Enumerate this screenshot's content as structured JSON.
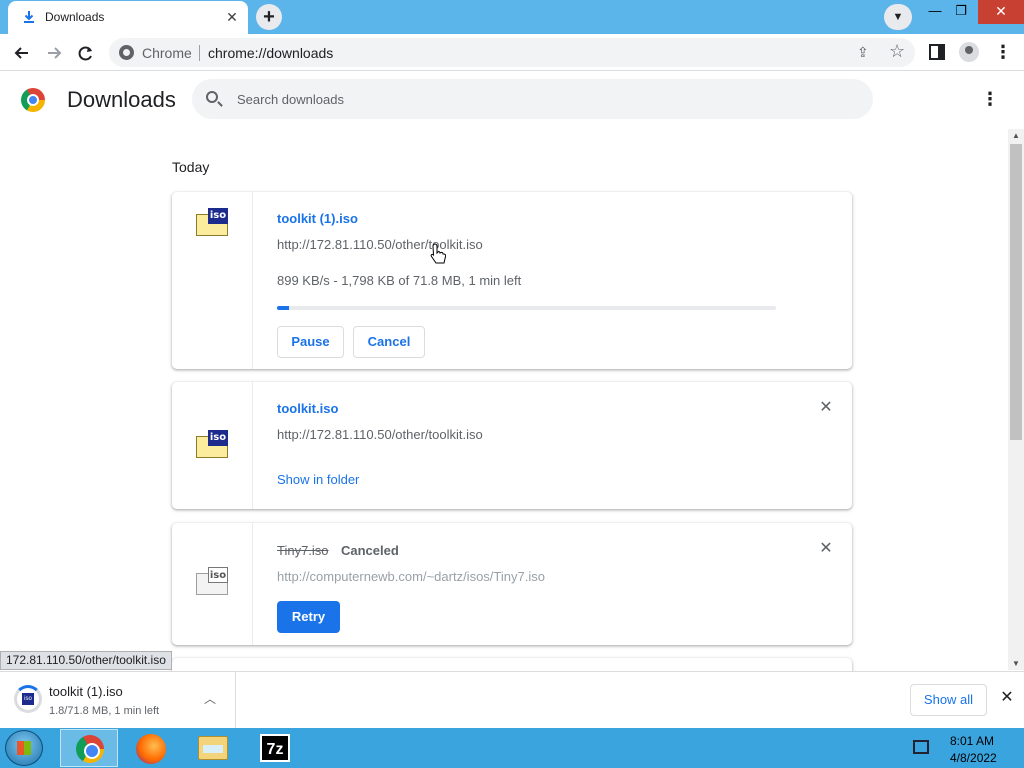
{
  "tab": {
    "title": "Downloads",
    "close_glyph": "✕"
  },
  "window_controls": {
    "minimize": "—",
    "restore": "❐",
    "close": "✕"
  },
  "toolbar": {
    "omnibox_site": "Chrome",
    "omnibox_url": "chrome://downloads"
  },
  "page": {
    "title": "Downloads",
    "search_placeholder": "Search downloads",
    "section": "Today"
  },
  "downloads": [
    {
      "name": "toolkit (1).iso",
      "url": "http://172.81.110.50/other/toolkit.iso",
      "progress_text": "899 KB/s - 1,798 KB of 71.8 MB, 1 min left",
      "progress_percent": 2.5,
      "actions": [
        "Pause",
        "Cancel"
      ]
    },
    {
      "name": "toolkit.iso",
      "url": "http://172.81.110.50/other/toolkit.iso",
      "action": "Show in folder"
    },
    {
      "name": "Tiny7.iso",
      "status": "Canceled",
      "url": "http://computernewb.com/~dartz/isos/Tiny7.iso",
      "action": "Retry"
    }
  ],
  "status_bar": "172.81.110.50/other/toolkit.iso",
  "shelf": {
    "name": "toolkit (1).iso",
    "status": "1.8/71.8 MB, 1 min left",
    "show_all": "Show all"
  },
  "taskbar": {
    "time": "8:01 AM",
    "date": "4/8/2022",
    "apps": [
      "chrome-icon",
      "firefox-icon",
      "file-explorer-icon",
      "7zip-icon"
    ]
  },
  "colors": {
    "accent": "#1a73e8",
    "titlebar": "#5bb5eb",
    "taskbar": "#3aa4df"
  }
}
